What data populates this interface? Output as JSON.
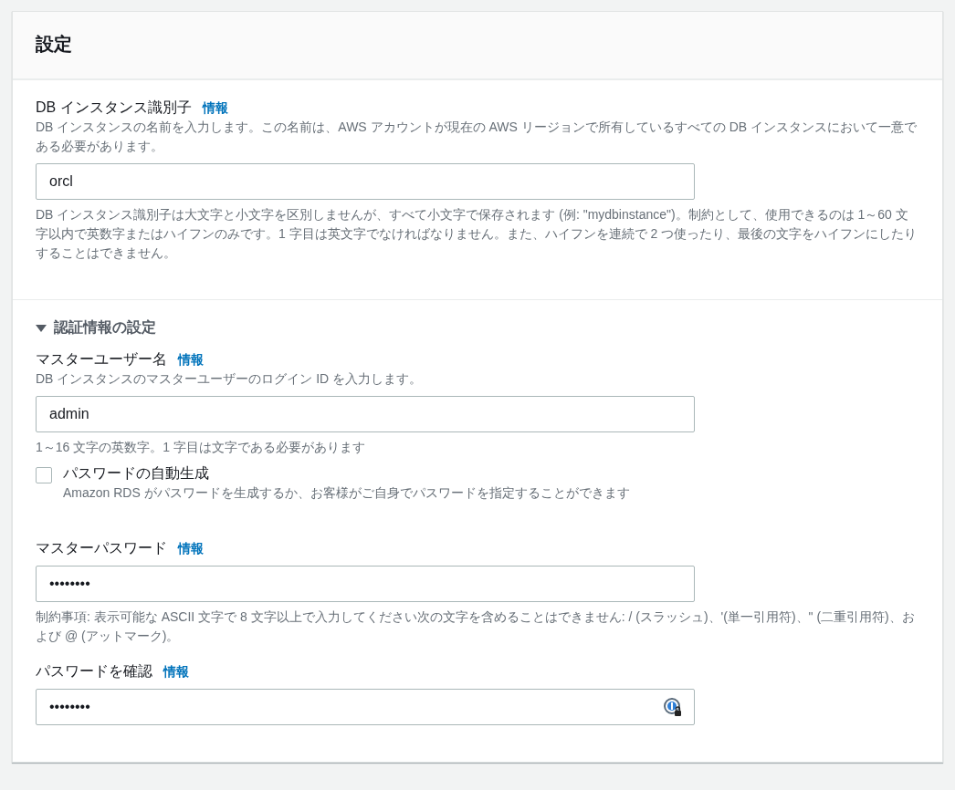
{
  "panel": {
    "title": "設定"
  },
  "sections": [
    {
      "fields": [
        {
          "kind": "text",
          "label": "DB インスタンス識別子",
          "info": "情報",
          "description": "DB インスタンスの名前を入力します。この名前は、AWS アカウントが現在の AWS リージョンで所有しているすべての DB インスタンスにおいて一意である必要があります。",
          "value": "orcl",
          "hint": "DB インスタンス識別子は大文字と小文字を区別しませんが、すべて小文字で保存されます (例: \"mydbinstance\")。制約として、使用できるのは 1～60 文字以内で英数字またはハイフンのみです。1 字目は英文字でなければなりません。また、ハイフンを連続で 2 つ使ったり、最後の文字をハイフンにしたりすることはできません。"
        }
      ]
    },
    {
      "toggle": {
        "label": "認証情報の設定",
        "expanded": true
      },
      "fields": [
        {
          "kind": "text",
          "label": "マスターユーザー名",
          "info": "情報",
          "description": "DB インスタンスのマスターユーザーのログイン ID を入力します。",
          "value": "admin",
          "hint": "1～16 文字の英数字。1 字目は文字である必要があります"
        },
        {
          "kind": "checkbox",
          "label": "パスワードの自動生成",
          "description": "Amazon RDS がパスワードを生成するか、お客様がご自身でパスワードを指定することができます",
          "checked": false
        },
        {
          "kind": "text",
          "label": "マスターパスワード",
          "info": "情報",
          "value": "••••••••",
          "hint": "制約事項: 表示可能な ASCII 文字で 8 文字以上で入力してください次の文字を含めることはできません: / (スラッシュ)、'(単一引用符)、\" (二重引用符)、および @ (アットマーク)。"
        },
        {
          "kind": "text",
          "label": "パスワードを確認",
          "info": "情報",
          "value": "••••••••",
          "password_manager_icon": true
        }
      ]
    }
  ]
}
